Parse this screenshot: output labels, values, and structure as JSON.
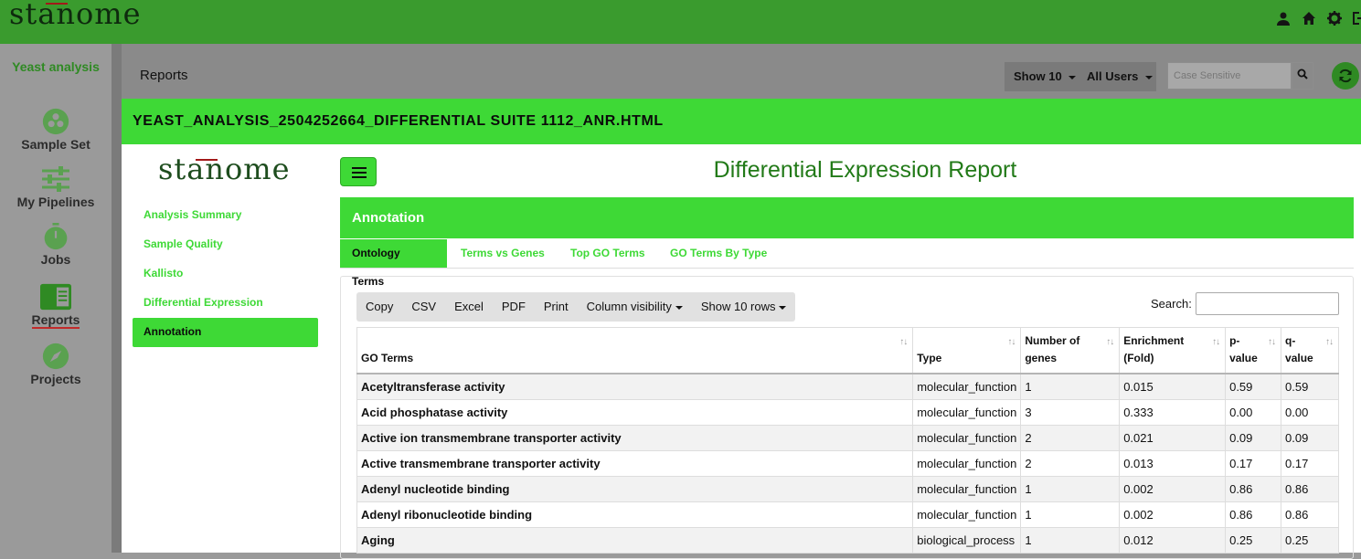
{
  "app": {
    "brand": "stanome",
    "icons": [
      "user-icon",
      "home-icon",
      "gear-icon",
      "logout-icon"
    ]
  },
  "leftnav": {
    "analysis_name": "Yeast analysis",
    "items": [
      {
        "label": "Sample Set",
        "icon": "sample-set-icon"
      },
      {
        "label": "My Pipelines",
        "icon": "sliders-icon"
      },
      {
        "label": "Jobs",
        "icon": "stopwatch-icon"
      },
      {
        "label": "Reports",
        "icon": "report-icon",
        "active": true
      },
      {
        "label": "Projects",
        "icon": "compass-icon"
      }
    ]
  },
  "reports_header": {
    "title": "Reports",
    "show_label": "Show 10",
    "users_label": "All Users",
    "search_placeholder": "Case Sensitive"
  },
  "file": {
    "name": "YEAST_ANALYSIS_2504252664_DIFFERENTIAL SUITE 1112_ANR.HTML"
  },
  "report": {
    "logo": "stanome",
    "title": "Differential Expression Report",
    "side_links": [
      {
        "label": "Analysis Summary"
      },
      {
        "label": "Sample Quality"
      },
      {
        "label": "Kallisto"
      },
      {
        "label": "Differential Expression"
      },
      {
        "label": "Annotation",
        "active": true
      }
    ],
    "section_title": "Annotation",
    "tabs": [
      {
        "label": "Ontology Terms",
        "active": true
      },
      {
        "label": "Terms vs Genes"
      },
      {
        "label": "Top GO Terms"
      },
      {
        "label": "GO Terms By Type"
      }
    ],
    "table_buttons": [
      "Copy",
      "CSV",
      "Excel",
      "PDF",
      "Print",
      "Column visibility",
      "Show 10 rows"
    ],
    "search_label": "Search:",
    "columns": [
      {
        "line1": "",
        "line2": "GO Terms"
      },
      {
        "line1": "",
        "line2": "Type"
      },
      {
        "line1": "Number of",
        "line2": "genes"
      },
      {
        "line1": "Enrichment",
        "line2": "(Fold)"
      },
      {
        "line1": "p-",
        "line2": "value"
      },
      {
        "line1": "q-",
        "line2": "value"
      }
    ],
    "rows": [
      [
        "Acetyltransferase activity",
        "molecular_function",
        "1",
        "0.015",
        "0.59",
        "0.59"
      ],
      [
        "Acid phosphatase activity",
        "molecular_function",
        "3",
        "0.333",
        "0.00",
        "0.00"
      ],
      [
        "Active ion transmembrane transporter activity",
        "molecular_function",
        "2",
        "0.021",
        "0.09",
        "0.09"
      ],
      [
        "Active transmembrane transporter activity",
        "molecular_function",
        "2",
        "0.013",
        "0.17",
        "0.17"
      ],
      [
        "Adenyl nucleotide binding",
        "molecular_function",
        "1",
        "0.002",
        "0.86",
        "0.86"
      ],
      [
        "Adenyl ribonucleotide binding",
        "molecular_function",
        "1",
        "0.002",
        "0.86",
        "0.86"
      ],
      [
        "Aging",
        "biological_process",
        "1",
        "0.012",
        "0.25",
        "0.25"
      ]
    ]
  },
  "colors": {
    "topbar": "#3a9b2e",
    "accent_green": "#3ed936",
    "title_green": "#227a18",
    "logo_bar_red": "#a31919"
  }
}
